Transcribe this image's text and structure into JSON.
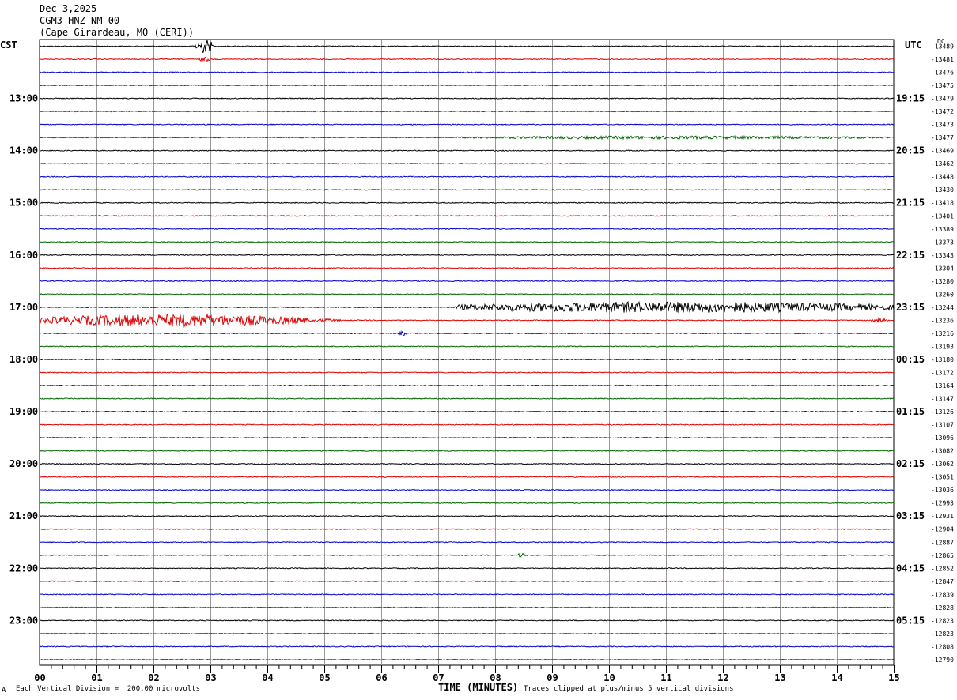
{
  "header": {
    "date": "Dec 3,2025",
    "channel": "CGM3 HNZ NM 00",
    "location": "(Cape Girardeau, MO (CERI))"
  },
  "left_zone": "CST",
  "right_zone": "UTC",
  "dc_label": "DC",
  "footer": {
    "scale": "Each Vertical Division =  200.00 microvolts",
    "clip": "Traces clipped at plus/minus 5 vertical divisions",
    "mark": "A"
  },
  "colors": [
    "#000000",
    "#dd0000",
    "#0000cc",
    "#006600"
  ],
  "chart_data": {
    "type": "line",
    "title": "CGM3 HNZ NM 00",
    "xlabel": "TIME (MINUTES)",
    "xlim": [
      0,
      15
    ],
    "x_ticks": [
      "00",
      "01",
      "02",
      "03",
      "04",
      "05",
      "06",
      "07",
      "08",
      "09",
      "10",
      "11",
      "12",
      "13",
      "14",
      "15"
    ],
    "left_labels": [
      "13:00",
      "14:00",
      "15:00",
      "16:00",
      "17:00",
      "18:00",
      "19:00",
      "20:00",
      "21:00",
      "22:00",
      "23:00"
    ],
    "right_labels": [
      "19:15",
      "20:15",
      "21:15",
      "22:15",
      "23:15",
      "00:15",
      "01:15",
      "02:15",
      "03:15",
      "04:15",
      "05:15"
    ],
    "dc_offsets": [
      "-13489",
      "-13481",
      "-13476",
      "-13475",
      "-13479",
      "-13472",
      "-13473",
      "-13477",
      "-13469",
      "-13462",
      "-13448",
      "-13430",
      "-13418",
      "-13401",
      "-13389",
      "-13373",
      "-13343",
      "-13304",
      "-13280",
      "-13260",
      "-13244",
      "-13236",
      "-13216",
      "-13193",
      "-13180",
      "-13172",
      "-13164",
      "-13147",
      "-13126",
      "-13107",
      "-13096",
      "-13082",
      "-13062",
      "-13051",
      "-13036",
      "-12993",
      "-12931",
      "-12904",
      "-12887",
      "-12865",
      "-12852",
      "-12847",
      "-12839",
      "-12828",
      "-12823",
      "-12823",
      "-12808",
      "-12790"
    ],
    "events": [
      {
        "trace": 0,
        "start": 2.72,
        "end": 3.05,
        "amplitude": 9
      },
      {
        "trace": 1,
        "start": 2.8,
        "end": 3.0,
        "amplitude": 3
      },
      {
        "trace": 20,
        "start": 7.3,
        "end": 15.0,
        "amplitude": 7
      },
      {
        "trace": 21,
        "start": 0.0,
        "end": 4.7,
        "amplitude": 8
      },
      {
        "trace": 21,
        "start": 4.7,
        "end": 5.3,
        "amplitude": 2
      },
      {
        "trace": 21,
        "start": 14.6,
        "end": 14.9,
        "amplitude": 3
      },
      {
        "trace": 22,
        "start": 6.3,
        "end": 6.45,
        "amplitude": 3
      },
      {
        "trace": 7,
        "start": 7.3,
        "end": 15.0,
        "amplitude": 2
      },
      {
        "trace": 39,
        "start": 8.4,
        "end": 8.55,
        "amplitude": 3
      }
    ]
  }
}
